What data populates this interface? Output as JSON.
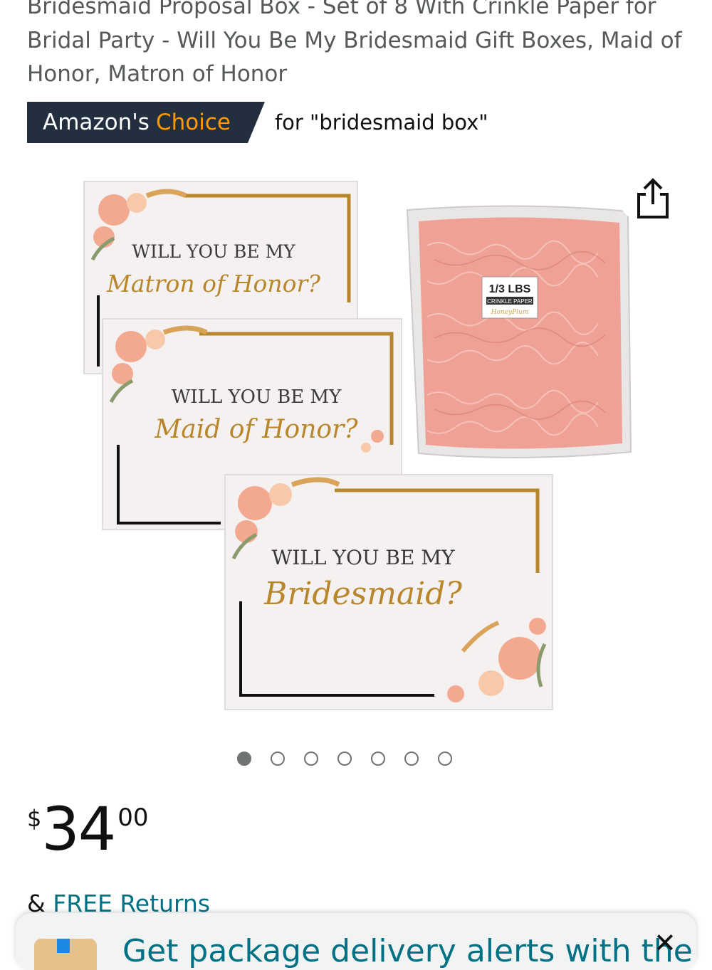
{
  "product": {
    "title": "Bridesmaid Proposal Box - Set of 8 With Crinkle Paper for Bridal Party - Will You Be My Bridesmaid Gift Boxes, Maid of Honor, Matron of Honor"
  },
  "badge": {
    "prefix": "Amazon's",
    "accent": "Choice",
    "query": "for \"bridesmaid box\""
  },
  "image": {
    "box1_line1": "WILL YOU BE MY",
    "box1_line2": "Matron of Honor?",
    "box2_line1": "WILL YOU BE MY",
    "box2_line2": "Maid of Honor?",
    "box3_line1": "WILL YOU BE MY",
    "box3_line2": "Bridesmaid?",
    "bag_label1": "1/3 LBS",
    "bag_label2": "CRINKLE PAPER",
    "bag_label3": "HoneyPlum"
  },
  "carousel": {
    "total": 7,
    "active": 1
  },
  "price": {
    "symbol": "$",
    "whole": "34",
    "fraction": "00"
  },
  "returns": {
    "amp": "&",
    "link": "FREE Returns"
  },
  "bottom_sheet": {
    "text": "Get package delivery alerts with the",
    "close": "✕"
  },
  "icons": {
    "share": "share-icon",
    "close": "close-icon"
  },
  "colors": {
    "badge_bg": "#232f3e",
    "badge_accent": "#ff9900",
    "link": "#007185",
    "gold": "#b8862b",
    "crinkle": "#f0a196"
  }
}
